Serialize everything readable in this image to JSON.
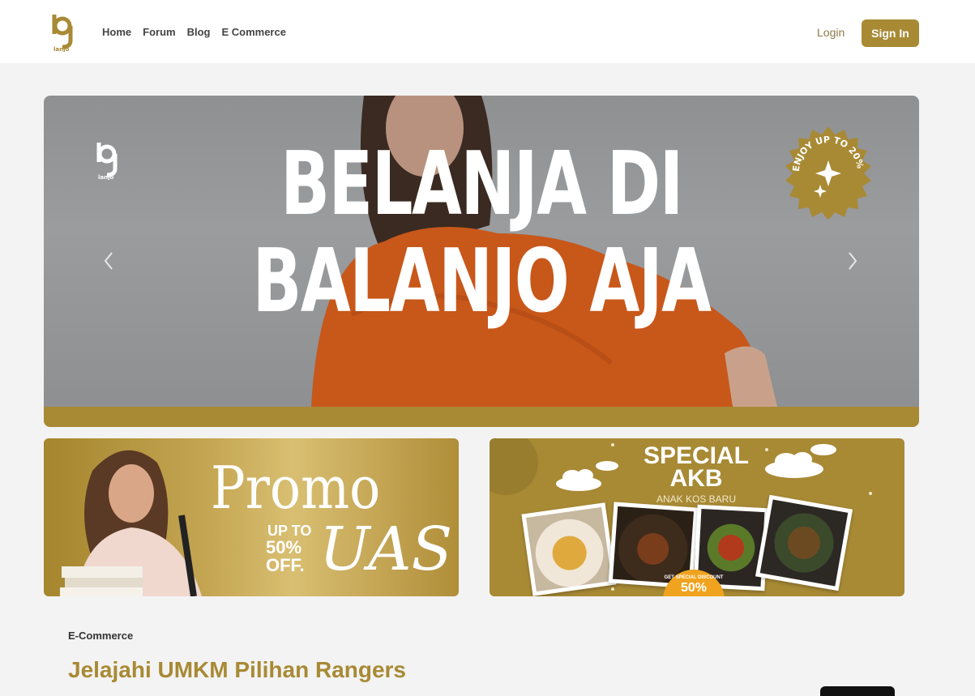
{
  "header": {
    "logo_text": "lanjo",
    "nav": [
      {
        "label": "Home"
      },
      {
        "label": "Forum"
      },
      {
        "label": "Blog"
      },
      {
        "label": "E Commerce"
      }
    ],
    "login_label": "Login",
    "signin_label": "Sign In"
  },
  "hero": {
    "line1": "BELANJA DI",
    "line2": "BALANJO AJA",
    "logo_text": "lanjo",
    "badge_text": "ENJOY UP TO 20% OFF"
  },
  "promo_uas": {
    "title": "Promo",
    "up_to": "UP TO",
    "percent": "50%",
    "off": "OFF.",
    "tag": "UAS"
  },
  "promo_akb": {
    "title_line1": "SPECIAL",
    "title_line2": "AKB",
    "subtitle": "ANAK KOS BARU",
    "discount_label": "GET SPECIAL DISCOUNT",
    "discount_value": "50%"
  },
  "section": {
    "label": "E-Commerce",
    "title": "Jelajahi UMKM Pilihan Rangers"
  },
  "colors": {
    "brand": "#a88a35",
    "header_bg": "#ffffff",
    "page_bg": "#f3f3f3"
  }
}
